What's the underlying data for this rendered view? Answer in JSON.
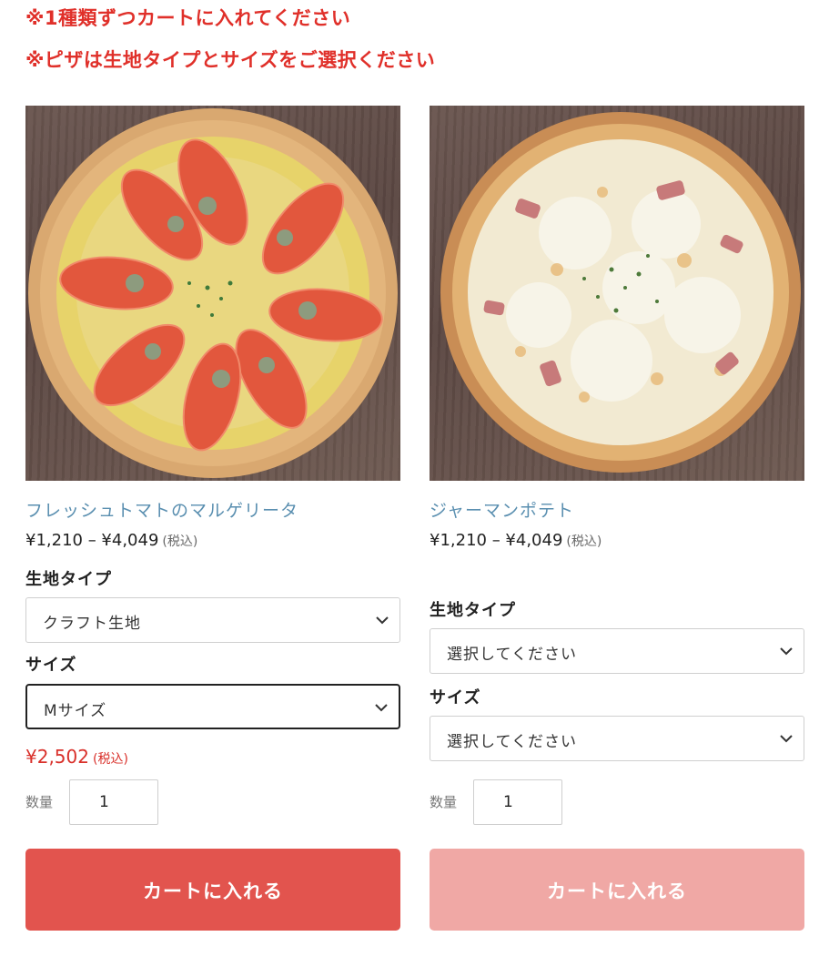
{
  "notices": [
    "※1種類ずつカートに入れてください",
    "※ピザは生地タイプとサイズをご選択ください"
  ],
  "products": [
    {
      "name": "フレッシュトマトのマルゲリータ",
      "price_range": "¥1,210 – ¥4,049",
      "tax_note": "(税込)",
      "dough_label": "生地タイプ",
      "dough_value": "クラフト生地",
      "size_label": "サイズ",
      "size_value": "Mサイズ",
      "selected_price": "¥2,502",
      "selected_tax_note": "(税込)",
      "qty_label": "数量",
      "qty_value": "1",
      "cart_label": "カートに入れる"
    },
    {
      "name": "ジャーマンポテト",
      "price_range": "¥1,210 – ¥4,049",
      "tax_note": "(税込)",
      "dough_label": "生地タイプ",
      "dough_value": "選択してください",
      "size_label": "サイズ",
      "size_value": "選択してください",
      "qty_label": "数量",
      "qty_value": "1",
      "cart_label": "カートに入れる"
    }
  ],
  "colors": {
    "notice": "#e0302a",
    "title": "#5a8fb0",
    "price_highlight": "#d9302a",
    "cart_button": "#e2544e",
    "cart_button_disabled": "#f0a8a5"
  },
  "icons": [
    "chevron-down-icon"
  ]
}
